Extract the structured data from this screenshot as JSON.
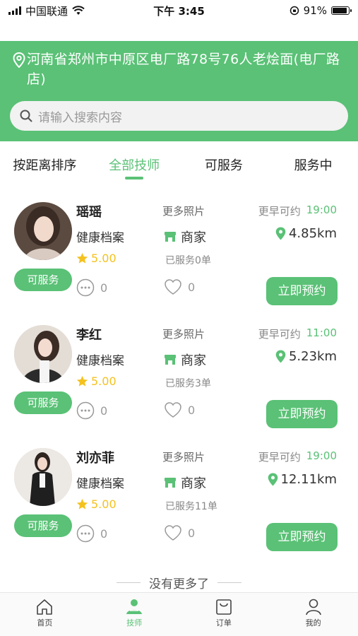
{
  "status_bar": {
    "carrier": "中国联通",
    "time": "下午 3:45",
    "battery": "91%",
    "battery_level": 0.91
  },
  "header": {
    "address": "河南省郑州市中原区电厂路78号76人老烩面(电厂路店)"
  },
  "search": {
    "placeholder": "请输入搜索内容"
  },
  "tabs": [
    {
      "label": "按距离排序"
    },
    {
      "label": "全部技师"
    },
    {
      "label": "可服务"
    },
    {
      "label": "服务中"
    }
  ],
  "labels": {
    "more_photos": "更多照片",
    "earliest": "更早可约",
    "merchant": "商家",
    "profile": "健康档案",
    "book": "立即预约"
  },
  "therapists": [
    {
      "name": "瑶瑶",
      "status": "可服务",
      "rating": "5.00",
      "comments": "0",
      "likes": "0",
      "served": "已服务0单",
      "time": "19:00",
      "distance": "4.85km"
    },
    {
      "name": "李红",
      "status": "可服务",
      "rating": "5.00",
      "comments": "0",
      "likes": "0",
      "served": "已服务3单",
      "time": "11:00",
      "distance": "5.23km"
    },
    {
      "name": "刘亦菲",
      "status": "可服务",
      "rating": "5.00",
      "comments": "0",
      "likes": "0",
      "served": "已服务11单",
      "time": "19:00",
      "distance": "12.11km"
    }
  ],
  "footer_note": "没有更多了",
  "tabbar": [
    {
      "label": "首页",
      "icon": "home-icon"
    },
    {
      "label": "技师",
      "icon": "therapist-icon"
    },
    {
      "label": "订单",
      "icon": "order-bag-icon"
    },
    {
      "label": "我的",
      "icon": "profile-icon"
    }
  ],
  "colors": {
    "brand_green": "#5ac176",
    "star_yellow": "#f4c21f"
  }
}
